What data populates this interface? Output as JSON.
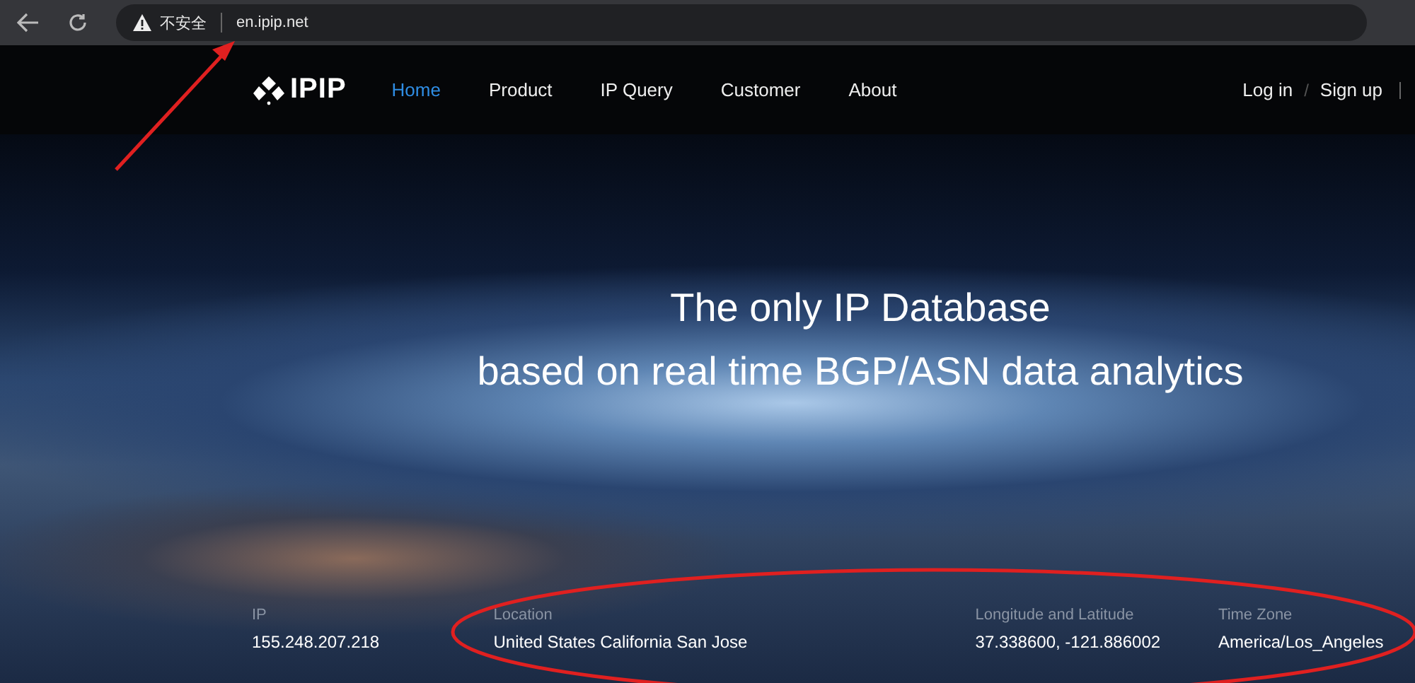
{
  "browser": {
    "security_label": "不安全",
    "url": "en.ipip.net"
  },
  "nav": {
    "logo": "IPIP",
    "items": [
      {
        "label": "Home",
        "selected": true
      },
      {
        "label": "Product",
        "selected": false
      },
      {
        "label": "IP Query",
        "selected": false
      },
      {
        "label": "Customer",
        "selected": false
      },
      {
        "label": "About",
        "selected": false
      }
    ],
    "login": "Log in",
    "separator": "/",
    "signup": "Sign up"
  },
  "hero": {
    "headline": [
      "The only IP Database",
      "based on real time BGP/ASN data analytics"
    ]
  },
  "ip_info": [
    {
      "label": "IP",
      "value": "155.248.207.218"
    },
    {
      "label": "Location",
      "value": "United States California San Jose"
    },
    {
      "label": "Longitude and Latitude",
      "value": "37.338600, -121.886002"
    },
    {
      "label": "Time Zone",
      "value": "America/Los_Angeles"
    }
  ]
}
